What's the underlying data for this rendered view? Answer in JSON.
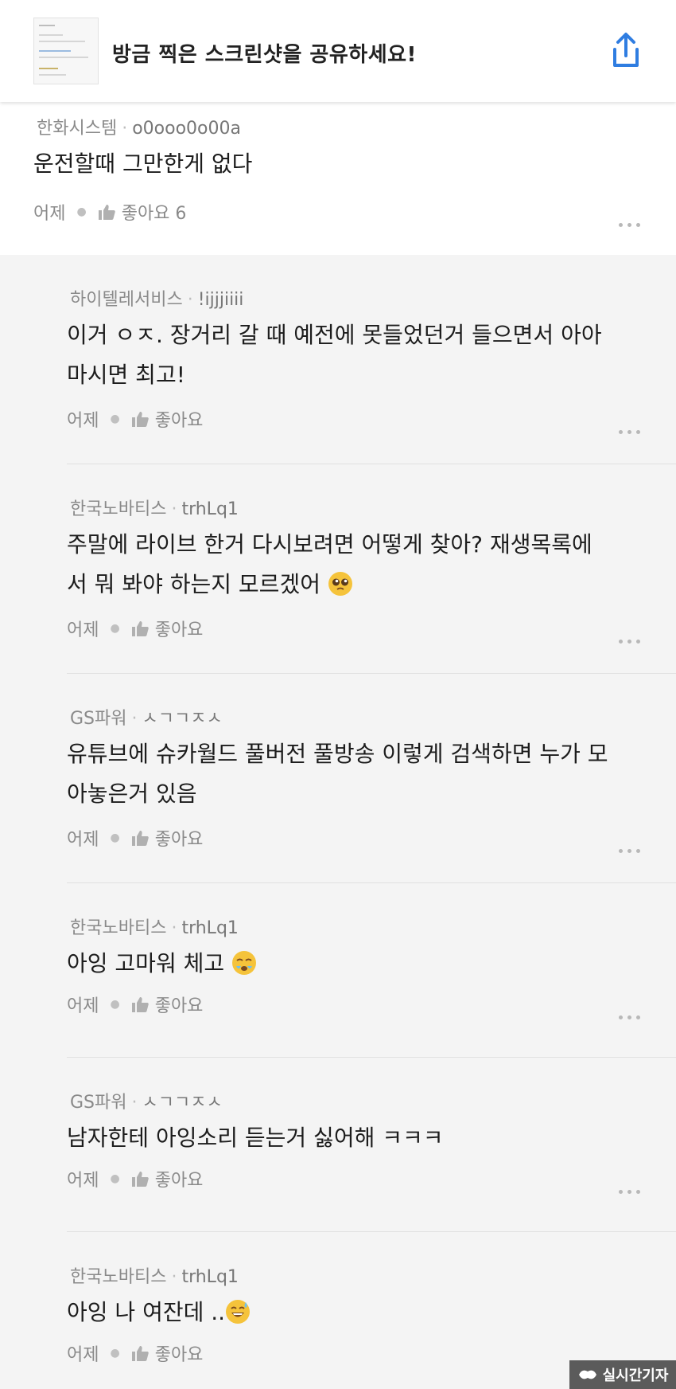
{
  "banner": {
    "title": "방금 찍은 스크린샷을 공유하세요!",
    "share_icon": "share-icon"
  },
  "top_comment": {
    "author": "한화시스템",
    "user_id": "o0ooo0o00a",
    "text": "운전할때 그만한게 없다",
    "time": "어제",
    "like_label": "좋아요 6"
  },
  "replies": [
    {
      "author": "하이텔레서비스",
      "user_id": "!ijjjiiii",
      "line1": "이거 ㅇㅈ. 장거리 갈 때 예전에 못들었던거 들으면서 아아",
      "line2": "마시면 최고!",
      "time": "어제",
      "like_label": "좋아요",
      "emoji": ""
    },
    {
      "author": "한국노바티스",
      "user_id": "trhLq1",
      "line1": "주말에 라이브 한거 다시보려면  어떻게 찾아? 재생목록에",
      "line2": "서 뭐 봐야 하는지 모르겠어 ",
      "time": "어제",
      "like_label": "좋아요",
      "emoji": "pleading-face"
    },
    {
      "author": "GS파워",
      "user_id": "ㅅㄱㄱㅈㅅ",
      "line1": "유튜브에 슈카월드 풀버전 풀방송 이렇게 검색하면 누가 모",
      "line2": "아놓은거 있음",
      "time": "어제",
      "like_label": "좋아요",
      "emoji": ""
    },
    {
      "author": "한국노바티스",
      "user_id": "trhLq1",
      "line1": "아잉 고마워 체고 ",
      "line2": "",
      "time": "어제",
      "like_label": "좋아요",
      "emoji": "face-holding-back-tears"
    },
    {
      "author": "GS파워",
      "user_id": "ㅅㄱㄱㅈㅅ",
      "line1": "남자한테 아잉소리 듣는거 싫어해 ㅋㅋㅋ",
      "line2": "",
      "time": "어제",
      "like_label": "좋아요",
      "emoji": ""
    },
    {
      "author": "한국노바티스",
      "user_id": "trhLq1",
      "line1": "아잉 나 여잔데 ..",
      "line2": "",
      "time": "어제",
      "like_label": "좋아요",
      "emoji": "grinning-sweat-face"
    }
  ],
  "watermark": {
    "label": "실시간기자"
  }
}
